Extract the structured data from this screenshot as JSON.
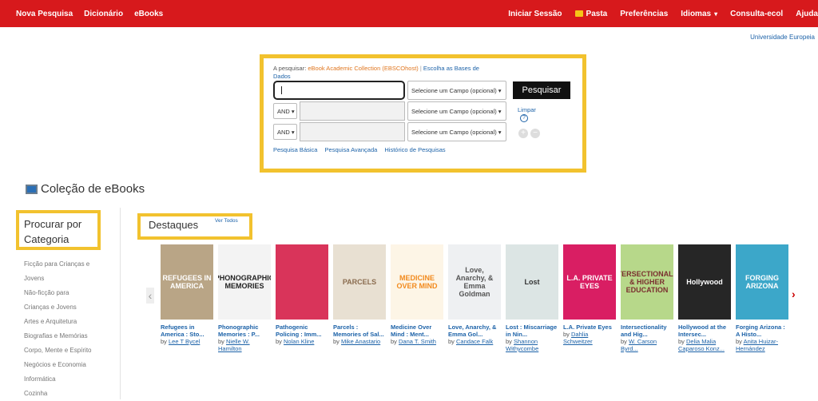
{
  "nav": {
    "left": [
      "Nova Pesquisa",
      "Dicionário",
      "eBooks"
    ],
    "right": [
      {
        "label": "Iniciar Sessão",
        "icon": ""
      },
      {
        "label": "Pasta",
        "icon": "folder-icon"
      },
      {
        "label": "Preferências",
        "icon": ""
      },
      {
        "label": "Idiomas",
        "caret": "▾"
      },
      {
        "label": "Consulta-ecol",
        "icon": ""
      },
      {
        "label": "Ajuda",
        "icon": ""
      }
    ]
  },
  "institution": "Universidade Europeia",
  "search": {
    "searching_prefix": "A pesquisar:",
    "database": "eBook Academic Collection (EBSCOhost)",
    "choose_db": "Escolha as Bases de Dados",
    "rows": [
      {
        "bool": "",
        "field": "Selecione um Campo (opcional) ▾"
      },
      {
        "bool": "AND ▾",
        "field": "Selecione um Campo (opcional) ▾"
      },
      {
        "bool": "AND ▾",
        "field": "Selecione um Campo (opcional) ▾"
      }
    ],
    "search_button": "Pesquisar",
    "clear": "Limpar",
    "help": "?",
    "add": "+",
    "remove": "−",
    "links": [
      "Pesquisa Básica",
      "Pesquisa Avançada",
      "Histórico de Pesquisas"
    ]
  },
  "section_title": "Coleção de eBooks",
  "browse": {
    "title": "Procurar por Categoria",
    "categories": [
      "Ficção para Crianças e",
      "Jovens",
      "Não-ficção para",
      "Crianças e Jovens",
      "Artes e Arquitetura",
      "Biografias e Memórias",
      "Corpo, Mente e Espírito",
      "Negócios e Economia",
      "Informática",
      "Cozinha"
    ]
  },
  "highlights": {
    "title": "Destaques",
    "see_all": "Ver Todos"
  },
  "carousel": {
    "prev": "‹",
    "next": "›"
  },
  "books": [
    {
      "title": "Refugees in America : Sto...",
      "by": "by",
      "author": "Lee T Bycel",
      "cover_text": "REFUGEES IN AMERICA",
      "cover_bg": "#b9a586",
      "cover_fg": "#ffffff"
    },
    {
      "title": "Phonographic Memories : P...",
      "by": "by",
      "author": "Nielle W. Hamilton",
      "cover_text": "PHONOGRAPHIC MEMORIES",
      "cover_bg": "#f3f3f3",
      "cover_fg": "#222222"
    },
    {
      "title": "Pathogenic Policing : Imm...",
      "by": "by",
      "author": "Nolan Kline",
      "cover_text": "",
      "cover_bg": "#d9345a",
      "cover_fg": "#ffffff"
    },
    {
      "title": "Parcels : Memories of Sal...",
      "by": "by",
      "author": "Mike Anastario",
      "cover_text": "PARCELS",
      "cover_bg": "#e8e0d2",
      "cover_fg": "#8a6c4f"
    },
    {
      "title": "Medicine Over Mind : Ment...",
      "by": "by",
      "author": "Dana T. Smith",
      "cover_text": "MEDICINE OVER MIND",
      "cover_bg": "#fdf5e6",
      "cover_fg": "#f28a1d"
    },
    {
      "title": "Love, Anarchy, & Emma Gol...",
      "by": "by",
      "author": "Candace Falk",
      "cover_text": "Love, Anarchy, & Emma Goldman",
      "cover_bg": "#eef0f2",
      "cover_fg": "#555555"
    },
    {
      "title": "Lost : Miscarriage in Nin...",
      "by": "by",
      "author": "Shannon Withycombe",
      "cover_text": "Lost",
      "cover_bg": "#dce5e4",
      "cover_fg": "#333333"
    },
    {
      "title": "L.A. Private Eyes",
      "by": "by",
      "author": "Dahlia Schweitzer",
      "cover_text": "L.A. PRIVATE EYES",
      "cover_bg": "#d91e63",
      "cover_fg": "#ffffff"
    },
    {
      "title": "Intersectionality and Hig...",
      "by": "by",
      "author": "W. Carson Byrd...",
      "cover_text": "INTERSECTIONALITY & HIGHER EDUCATION",
      "cover_bg": "#b7d88a",
      "cover_fg": "#7a2f2f"
    },
    {
      "title": "Hollywood at the Intersec...",
      "by": "by",
      "author": "Delia Malia Caparoso Konz...",
      "cover_text": "Hollywood",
      "cover_bg": "#262626",
      "cover_fg": "#ffffff"
    },
    {
      "title": "Forging Arizona : A Histo...",
      "by": "by",
      "author": "Anita Huizar-Hernández",
      "cover_text": "FORGING ARIZONA",
      "cover_bg": "#3ca7c9",
      "cover_fg": "#ffffff"
    }
  ]
}
